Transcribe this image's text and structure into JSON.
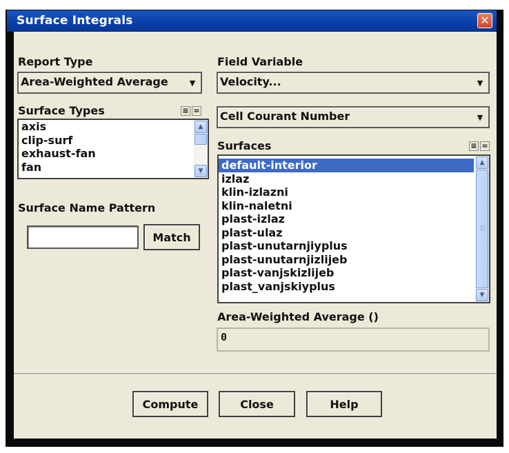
{
  "window": {
    "title": "Surface Integrals"
  },
  "report_type": {
    "label": "Report Type",
    "value": "Area-Weighted Average"
  },
  "field_variable": {
    "label": "Field Variable",
    "category": "Velocity...",
    "variable": "Cell Courant Number"
  },
  "surface_types": {
    "label": "Surface Types",
    "items": [
      "axis",
      "clip-surf",
      "exhaust-fan",
      "fan"
    ]
  },
  "surface_name_pattern": {
    "label": "Surface Name Pattern",
    "value": "",
    "match_label": "Match"
  },
  "surfaces": {
    "label": "Surfaces",
    "selected_index": 0,
    "items": [
      "default-interior",
      "izlaz",
      "klin-izlazni",
      "klin-naletni",
      "plast-izlaz",
      "plast-ulaz",
      "plast-unutarnjiyplus",
      "plast-unutarnjizlijeb",
      "plast-vanjskizlijeb",
      "plast_vanjskiyplus"
    ]
  },
  "result": {
    "label": "Area-Weighted Average ()",
    "value": "0"
  },
  "buttons": {
    "compute": "Compute",
    "close": "Close",
    "help": "Help"
  },
  "select_all_glyph": "≡",
  "deselect_all_glyph": "=",
  "colors": {
    "title_bar": "#0a3fa6",
    "selection": "#3c6bc6",
    "close_button": "#d4452a",
    "dialog_bg": "#ece9d8"
  }
}
